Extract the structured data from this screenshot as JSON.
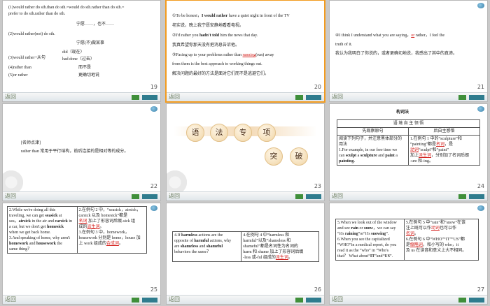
{
  "footer": {
    "label": "返回",
    "left_btn": "",
    "right_btn": "",
    "extra_btn": ""
  },
  "slides": [
    {
      "num": "19",
      "lines": {
        "l1": "(1)would rather do sth.than do sth.=would do sth.rather than do sth.=",
        "l2": "prefer to do sth.rather than do sth.",
        "l3": "宁愿……，也不……",
        "l4": "(2)would rather(not) do sth.",
        "l5": "宁愿(不)做某事",
        "l6a": "did（现在）",
        "l6b": "(3)would rather+从句",
        "l6c": "had done（过去）",
        "l7a": "(4)rather than",
        "l7b": "而不是",
        "l8a": "(5)or rather",
        "l8b": "更确切地说"
      }
    },
    {
      "num": "20",
      "lines": {
        "l1a": "①To be honest，",
        "l1b": "I would rather",
        "l1c": " have a quiet night in front of the TV",
        "l2": "老实说，晚上我宁愿安静地看看电视。",
        "l3a": "②I'd rather you ",
        "l3b": "hadn't told",
        "l3c": " him the news that day.",
        "l4": "我真希望你那天没有把消息告诉他。",
        "l5a": "③Facing up to your problems rather than ",
        "l5b": "running",
        "l5c": "(run) away",
        "l6": "from them is the best approach to working things out.",
        "l7": "解决问题的最好的方法是面对它们而不是逃避它们。"
      }
    },
    {
      "num": "21",
      "lines": {
        "l1a": "④I think I understand what you are saying，",
        "l1b": "or",
        "l1c": " rather，I feel the",
        "l2": "truth of it.",
        "l3": "我认为我明白了你说的，或者更确切地说，我感出了其中的真谛。"
      }
    },
    {
      "num": "22",
      "lines": {
        "l1": "[名师点津]",
        "l2": "rather than 常用于平行结构，前后连接的是相对等的成分。"
      }
    },
    {
      "num": "23",
      "title": [
        "语",
        "法",
        "专",
        "项"
      ],
      "sub": [
        "突",
        "破"
      ]
    },
    {
      "num": "24",
      "heading": "构词法",
      "table": {
        "h1": "语 境 自 主 领 悟",
        "h2a": "先观察原句",
        "h2b": "后自主感悟",
        "c1l1": "阅读下列句子，并注意黑体部分的",
        "c1l2": "用法",
        "c1l3": "1.For example, in our free time we",
        "c1l4a": "can ",
        "c1l4b": "sculpt",
        "c1l4c": " a ",
        "c1l4d": "sculpture",
        "c1l4e": " and ",
        "c1l4f": "paint",
        "c1l4g": " a",
        "c1l5": "painting.",
        "c2l1": "1.在例句 1 中的“sculpture”和",
        "c2l2a": "“painting”都是",
        "c2l2b": "名词",
        "c2l2c": "，是",
        "c2l3a": "",
        "c2l3b": "动词",
        "c2l3c": "“sculpt”和“paint”",
        "c2l4a": "加上",
        "c2l4b": "派生词",
        "c2l4c": "，分别加了名词后缀",
        "c2l5": "-ure 和-ing。"
      }
    },
    {
      "num": "25",
      "left": {
        "l1": "2.While we're doing all this",
        "l2a": "traveling, we can get ",
        "l2b": "seasick",
        "l2c": " at",
        "l3a": "sea，",
        "l3b": "airsick",
        "l3c": " in the air and ",
        "l3d": "carsick",
        "l3e": " in",
        "l4a": "a car, but we don't get ",
        "l4b": "homesick",
        "l5": "when we get back home.",
        "l6": "3.And speaking of home, why aren't",
        "l7a": "",
        "l7b": "homework",
        "l7c": " and ",
        "l7d": "housework",
        "l7e": " the",
        "l8": "same thing？"
      },
      "right": {
        "l1": "2.在例句 2 中，“seasick，airsick，",
        "l2": "carsick 以及 homesick”都是",
        "l3a": "",
        "l3b": "名词",
        "l3c": " 加上了形容词后缀-sick 组",
        "l4a": "成的",
        "l4b": "派生词",
        "l4c": "。",
        "l5": "3.在例句 3 中，homework，",
        "l6": "housework 分别是 home，house 加",
        "l7a": "上 work 组成的",
        "l7b": "合成词",
        "l7c": "。"
      }
    },
    {
      "num": "26",
      "left": {
        "l1a": "4.If ",
        "l1b": "harmless",
        "l1c": " actions are the",
        "l2a": "opposite of ",
        "l2b": "harmful",
        "l2c": " actions, why",
        "l3a": "are ",
        "l3b": "shameless",
        "l3c": " and ",
        "l3d": "shameful",
        "l4": "behaviors the same？"
      },
      "right": {
        "l1": "4.在例句 4 中“harmless 和",
        "l2": "harmful”以及“shameless 和",
        "l3": "shameful”都是名词性为名词的",
        "l4": "harm 和 shame 加上了形容词后缀",
        "l5a": "-less 或-ful 组成的",
        "l5b": "派生词",
        "l5c": "。"
      }
    },
    {
      "num": "27",
      "left": {
        "l1": "5.When we look out of the window",
        "l2a": "and see ",
        "l2b": "rain",
        "l2c": " or ",
        "l2d": "snow",
        "l2e": "，we can say",
        "l3a": "“it's ",
        "l3b": "raining",
        "l3c": "”or“it's ",
        "l3d": "snowing",
        "l3e": "”.",
        "l4": "6.When you see the capitalized",
        "l5": "“WHO”in a medical report, do you",
        "l6": "read it as the “who” in “Who's",
        "l7a": "that？ What about“",
        "l7b": "IT",
        "l7c": "”and“",
        "l7d": "US",
        "l7e": "”."
      },
      "right": {
        "l1": "5.在例句 5 中“rain”和“snow”在该",
        "l2a": "注上既可以作",
        "l2b": "动词",
        "l2c": "也可以作",
        "l3a": "",
        "l3b": "名词",
        "l3c": "。",
        "l4": "6.在例句 6 中“WHO”“IT”“US”都",
        "l5a": "是",
        "l5b": "缩略词",
        "l5c": "，和小写的 who，it",
        "l6": "及 us 在读音和意义上大不相同。"
      }
    }
  ]
}
